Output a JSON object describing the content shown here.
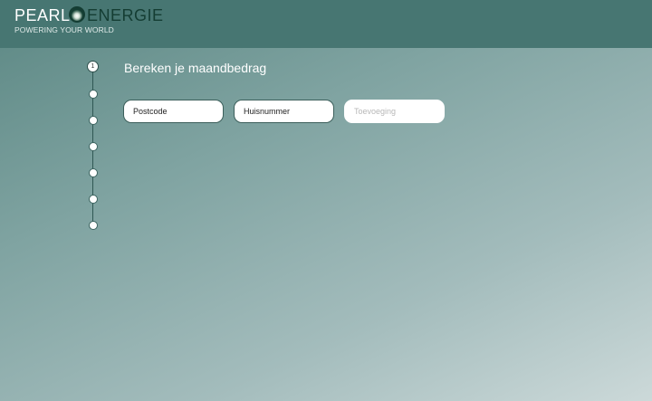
{
  "header": {
    "logo": {
      "word_left": "PEARL",
      "word_right": "ENERGIE",
      "tagline": "POWERING YOUR WORLD"
    }
  },
  "stepper": {
    "active_step_label": "1",
    "total_steps": 7,
    "active_step": 1
  },
  "form": {
    "title": "Bereken je maandbedrag",
    "fields": [
      {
        "placeholder": "Postcode",
        "value": ""
      },
      {
        "placeholder": "Huisnummer",
        "value": ""
      },
      {
        "placeholder": "Toevoeging",
        "value": ""
      }
    ]
  },
  "colors": {
    "header_bg": "#477672",
    "brand_dark_green": "#143d33",
    "page_gradient_start": "#5b8783",
    "page_gradient_end": "#ccd9d9"
  }
}
